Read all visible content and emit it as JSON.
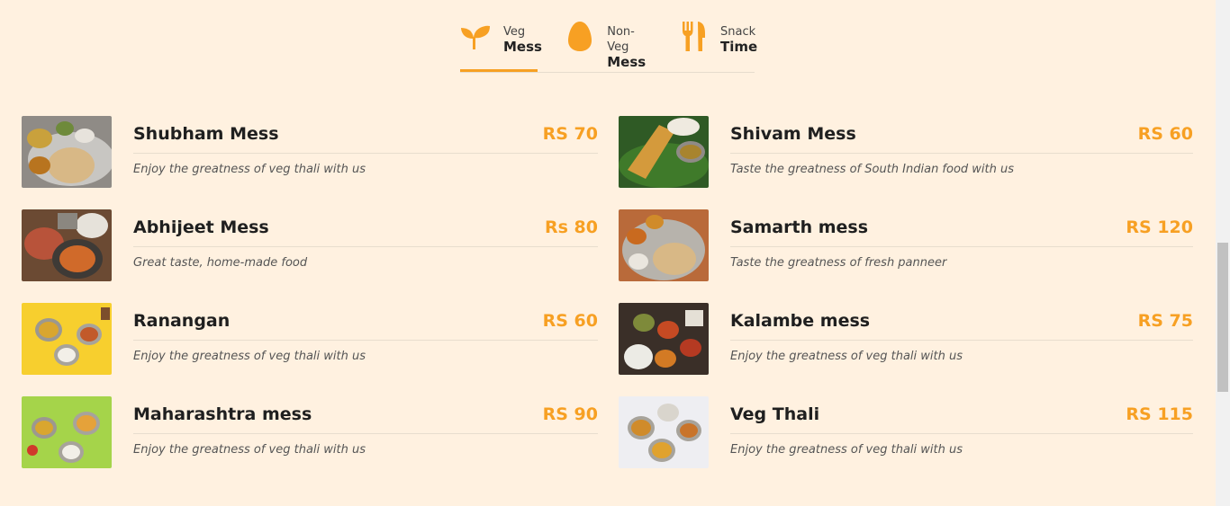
{
  "tabs": [
    {
      "small": "Veg",
      "big": "Mess",
      "icon": "sprout-icon",
      "active": true
    },
    {
      "small": "Non-Veg",
      "big": "Mess",
      "icon": "egg-icon",
      "active": false
    },
    {
      "small": "Snack",
      "big": "Time",
      "icon": "fork-knife-icon",
      "active": false
    }
  ],
  "accent_color": "#f7a023",
  "menu": {
    "left": [
      {
        "name": "Shubham Mess",
        "price": "RS 70",
        "desc": "Enjoy the greatness of veg thali with us"
      },
      {
        "name": "Abhijeet Mess",
        "price": "Rs 80",
        "desc": "Great taste, home-made food"
      },
      {
        "name": "Ranangan",
        "price": "RS 60",
        "desc": "Enjoy the greatness of veg thali with us"
      },
      {
        "name": "Maharashtra mess",
        "price": "RS 90",
        "desc": "Enjoy the greatness of veg thali with us"
      }
    ],
    "right": [
      {
        "name": "Shivam Mess",
        "price": "RS 60",
        "desc": "Taste the greatness of South Indian food with us"
      },
      {
        "name": "Samarth mess",
        "price": "RS 120",
        "desc": "Taste the greatness of fresh panneer"
      },
      {
        "name": "Kalambe mess",
        "price": "RS 75",
        "desc": "Enjoy the greatness of veg thali with us"
      },
      {
        "name": "Veg Thali",
        "price": "RS 115",
        "desc": "Enjoy the greatness of veg thali with us"
      }
    ]
  }
}
